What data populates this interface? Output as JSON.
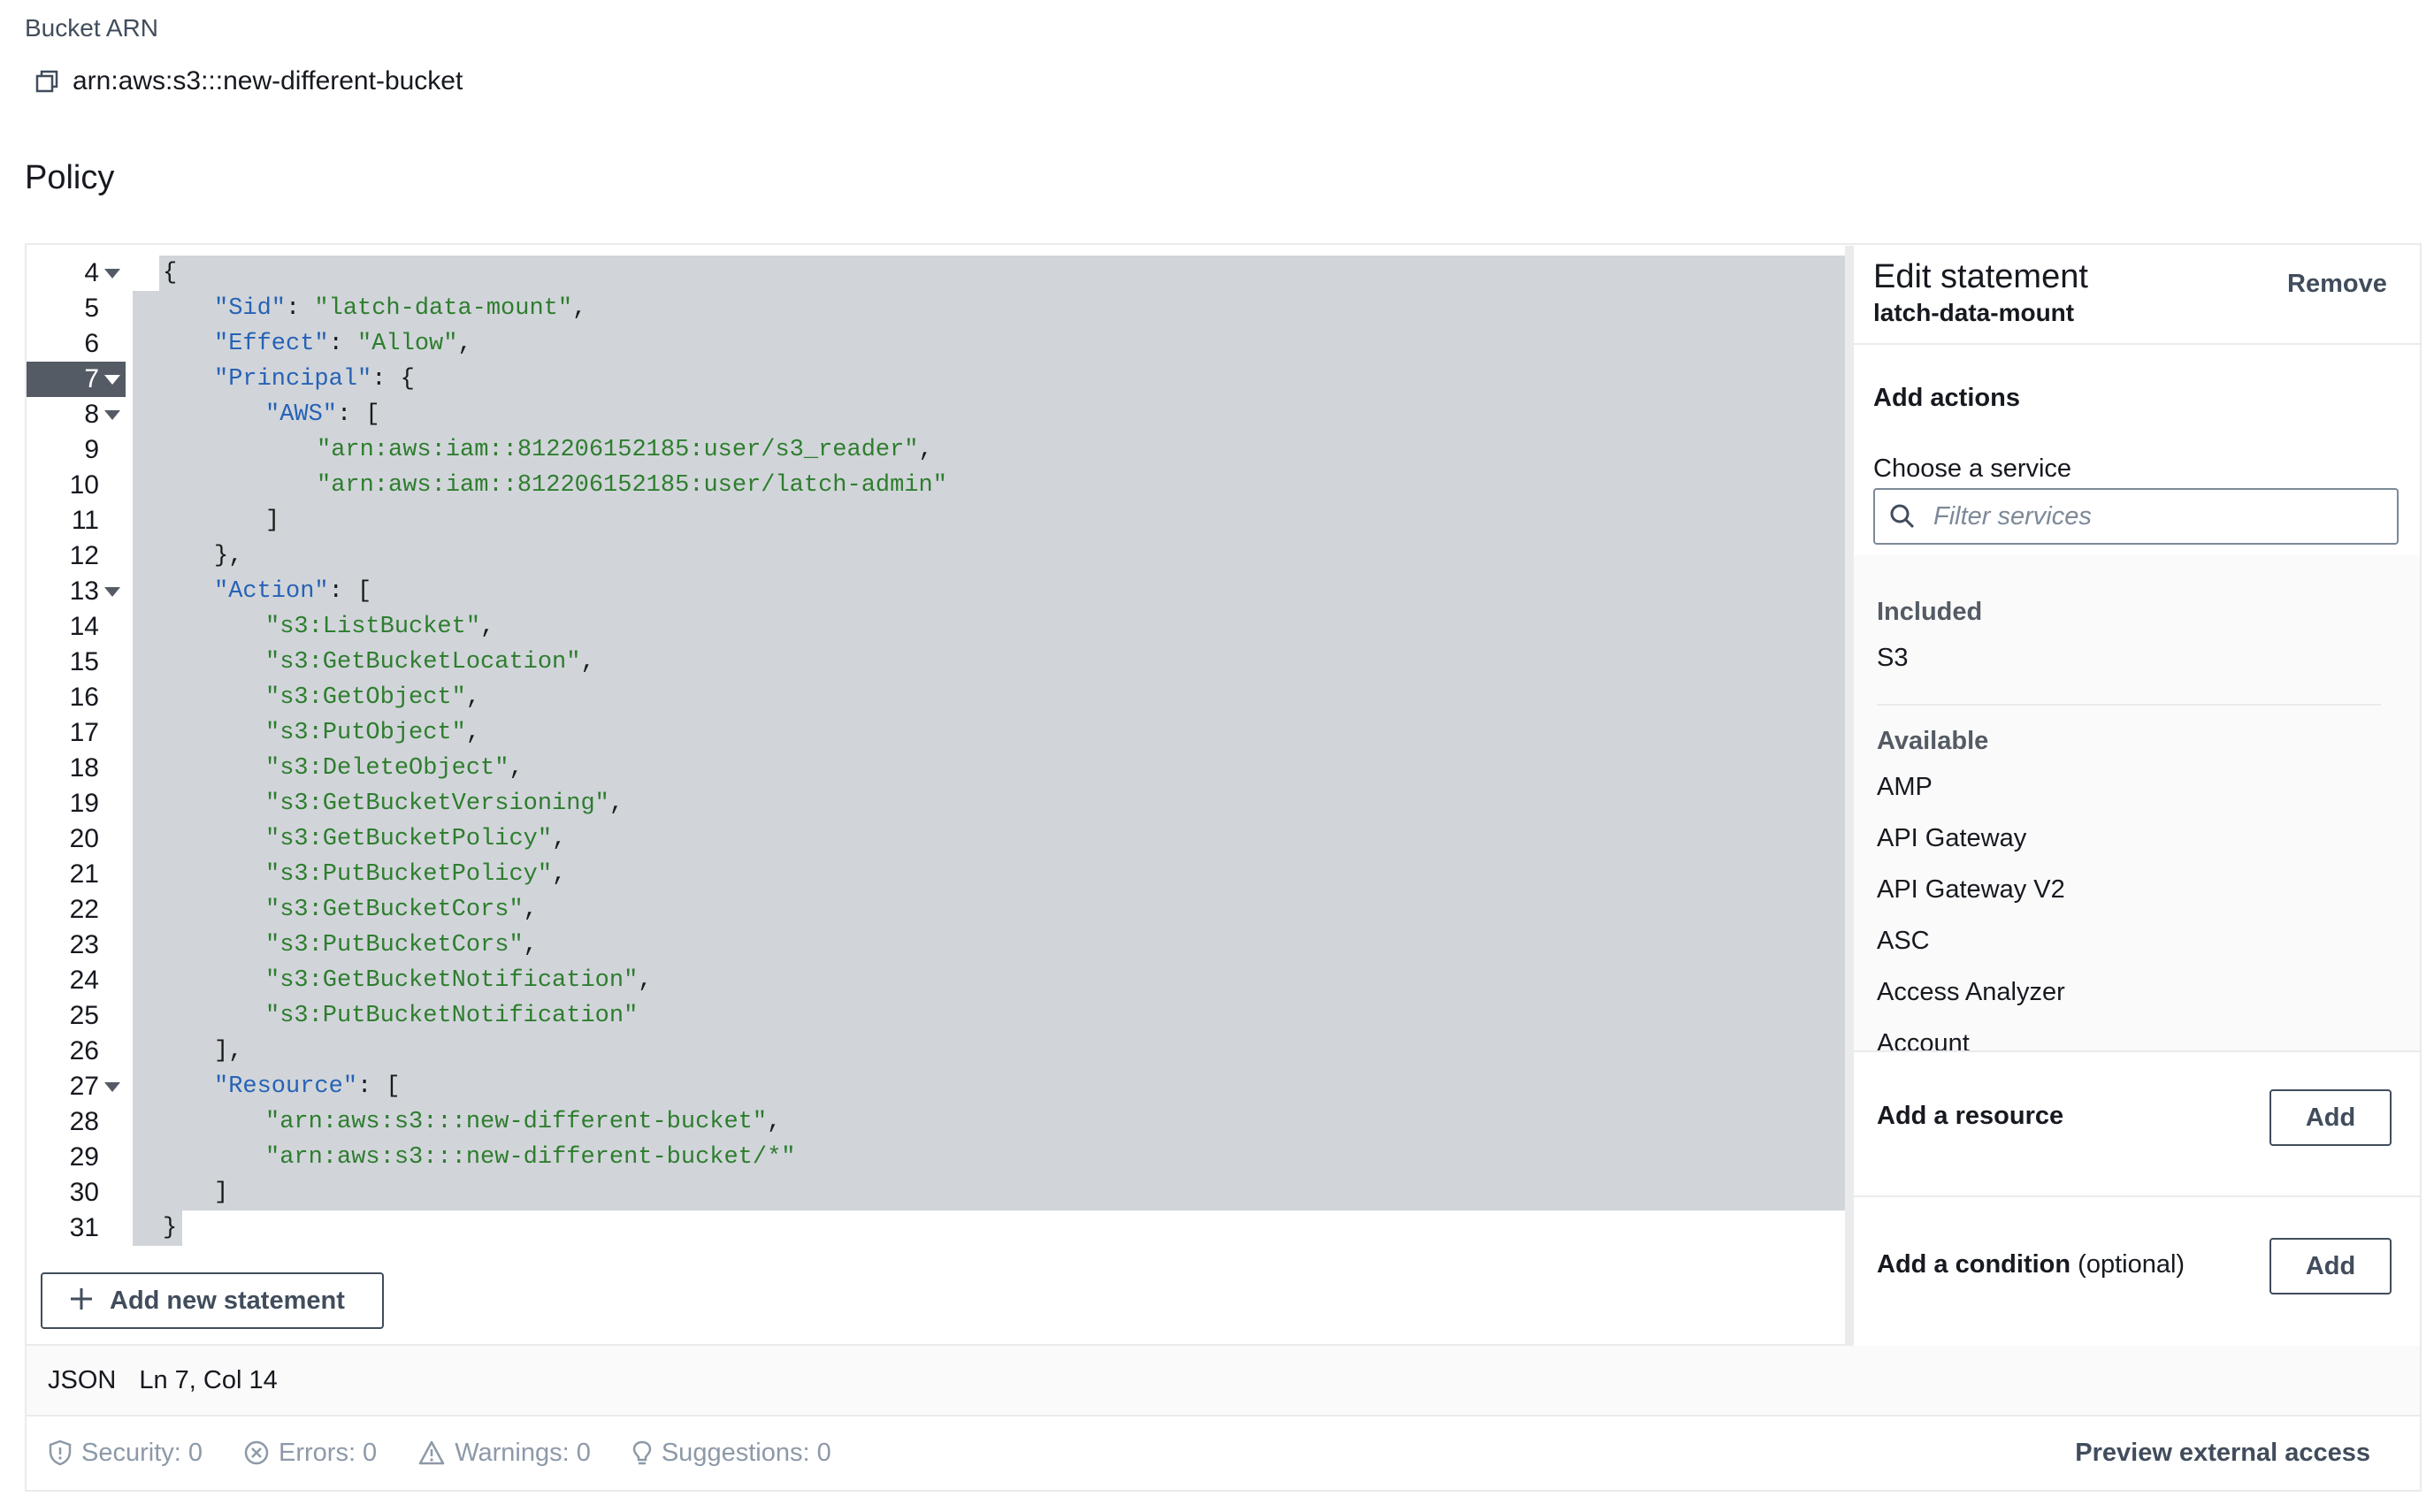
{
  "bucket": {
    "arn_label": "Bucket ARN",
    "arn_value": "arn:aws:s3:::new-different-bucket"
  },
  "policy_title": "Policy",
  "editor": {
    "active_line": 7,
    "lines": [
      {
        "n": "4",
        "fold": true,
        "indent": 2,
        "parts": [
          [
            "p",
            "{"
          ]
        ]
      },
      {
        "n": "5",
        "fold": false,
        "indent": 3,
        "parts": [
          [
            "k",
            "\"Sid\""
          ],
          [
            "p",
            ": "
          ],
          [
            "s",
            "\"latch-data-mount\""
          ],
          [
            "p",
            ","
          ]
        ]
      },
      {
        "n": "6",
        "fold": false,
        "indent": 3,
        "parts": [
          [
            "k",
            "\"Effect\""
          ],
          [
            "p",
            ": "
          ],
          [
            "s",
            "\"Allow\""
          ],
          [
            "p",
            ","
          ]
        ]
      },
      {
        "n": "7",
        "fold": true,
        "indent": 3,
        "parts": [
          [
            "k",
            "\"Principal\""
          ],
          [
            "p",
            ": {"
          ]
        ]
      },
      {
        "n": "8",
        "fold": true,
        "indent": 4,
        "parts": [
          [
            "k",
            "\"AWS\""
          ],
          [
            "p",
            ": ["
          ]
        ]
      },
      {
        "n": "9",
        "fold": false,
        "indent": 5,
        "parts": [
          [
            "s",
            "\"arn:aws:iam::812206152185:user/s3_reader\""
          ],
          [
            "p",
            ","
          ]
        ]
      },
      {
        "n": "10",
        "fold": false,
        "indent": 5,
        "parts": [
          [
            "s",
            "\"arn:aws:iam::812206152185:user/latch-admin\""
          ]
        ]
      },
      {
        "n": "11",
        "fold": false,
        "indent": 4,
        "parts": [
          [
            "p",
            "]"
          ]
        ]
      },
      {
        "n": "12",
        "fold": false,
        "indent": 3,
        "parts": [
          [
            "p",
            "},"
          ]
        ]
      },
      {
        "n": "13",
        "fold": true,
        "indent": 3,
        "parts": [
          [
            "k",
            "\"Action\""
          ],
          [
            "p",
            ": ["
          ]
        ]
      },
      {
        "n": "14",
        "fold": false,
        "indent": 4,
        "parts": [
          [
            "s",
            "\"s3:ListBucket\""
          ],
          [
            "p",
            ","
          ]
        ]
      },
      {
        "n": "15",
        "fold": false,
        "indent": 4,
        "parts": [
          [
            "s",
            "\"s3:GetBucketLocation\""
          ],
          [
            "p",
            ","
          ]
        ]
      },
      {
        "n": "16",
        "fold": false,
        "indent": 4,
        "parts": [
          [
            "s",
            "\"s3:GetObject\""
          ],
          [
            "p",
            ","
          ]
        ]
      },
      {
        "n": "17",
        "fold": false,
        "indent": 4,
        "parts": [
          [
            "s",
            "\"s3:PutObject\""
          ],
          [
            "p",
            ","
          ]
        ]
      },
      {
        "n": "18",
        "fold": false,
        "indent": 4,
        "parts": [
          [
            "s",
            "\"s3:DeleteObject\""
          ],
          [
            "p",
            ","
          ]
        ]
      },
      {
        "n": "19",
        "fold": false,
        "indent": 4,
        "parts": [
          [
            "s",
            "\"s3:GetBucketVersioning\""
          ],
          [
            "p",
            ","
          ]
        ]
      },
      {
        "n": "20",
        "fold": false,
        "indent": 4,
        "parts": [
          [
            "s",
            "\"s3:GetBucketPolicy\""
          ],
          [
            "p",
            ","
          ]
        ]
      },
      {
        "n": "21",
        "fold": false,
        "indent": 4,
        "parts": [
          [
            "s",
            "\"s3:PutBucketPolicy\""
          ],
          [
            "p",
            ","
          ]
        ]
      },
      {
        "n": "22",
        "fold": false,
        "indent": 4,
        "parts": [
          [
            "s",
            "\"s3:GetBucketCors\""
          ],
          [
            "p",
            ","
          ]
        ]
      },
      {
        "n": "23",
        "fold": false,
        "indent": 4,
        "parts": [
          [
            "s",
            "\"s3:PutBucketCors\""
          ],
          [
            "p",
            ","
          ]
        ]
      },
      {
        "n": "24",
        "fold": false,
        "indent": 4,
        "parts": [
          [
            "s",
            "\"s3:GetBucketNotification\""
          ],
          [
            "p",
            ","
          ]
        ]
      },
      {
        "n": "25",
        "fold": false,
        "indent": 4,
        "parts": [
          [
            "s",
            "\"s3:PutBucketNotification\""
          ]
        ]
      },
      {
        "n": "26",
        "fold": false,
        "indent": 3,
        "parts": [
          [
            "p",
            "],"
          ]
        ]
      },
      {
        "n": "27",
        "fold": true,
        "indent": 3,
        "parts": [
          [
            "k",
            "\"Resource\""
          ],
          [
            "p",
            ": ["
          ]
        ]
      },
      {
        "n": "28",
        "fold": false,
        "indent": 4,
        "parts": [
          [
            "s",
            "\"arn:aws:s3:::new-different-bucket\""
          ],
          [
            "p",
            ","
          ]
        ]
      },
      {
        "n": "29",
        "fold": false,
        "indent": 4,
        "parts": [
          [
            "s",
            "\"arn:aws:s3:::new-different-bucket/*\""
          ]
        ]
      },
      {
        "n": "30",
        "fold": false,
        "indent": 3,
        "parts": [
          [
            "p",
            "]"
          ]
        ]
      },
      {
        "n": "31",
        "fold": false,
        "indent": 2,
        "parts": [
          [
            "p",
            "}"
          ]
        ]
      }
    ],
    "add_statement_label": "Add new statement"
  },
  "status": {
    "language": "JSON",
    "cursor": "Ln 7, Col 14",
    "security": "Security: 0",
    "errors": "Errors: 0",
    "warnings": "Warnings: 0",
    "suggestions": "Suggestions: 0",
    "preview_label": "Preview external access"
  },
  "panel": {
    "title": "Edit statement",
    "statement_id": "latch-data-mount",
    "remove_label": "Remove",
    "add_actions_label": "Add actions",
    "choose_service_label": "Choose a service",
    "filter_placeholder": "Filter services",
    "included_heading": "Included",
    "included": [
      "S3"
    ],
    "available_heading": "Available",
    "available": [
      "AMP",
      "API Gateway",
      "API Gateway V2",
      "ASC",
      "Access Analyzer",
      "Account"
    ],
    "add_resource_label": "Add a resource",
    "add_resource_button": "Add",
    "add_condition_label": "Add a condition",
    "add_condition_optional": "(optional)",
    "add_condition_button": "Add"
  },
  "colors": {
    "string": "#2e7d2e",
    "key": "#2762b5",
    "selection": "#d1d5da",
    "active_gutter": "#545b64"
  }
}
